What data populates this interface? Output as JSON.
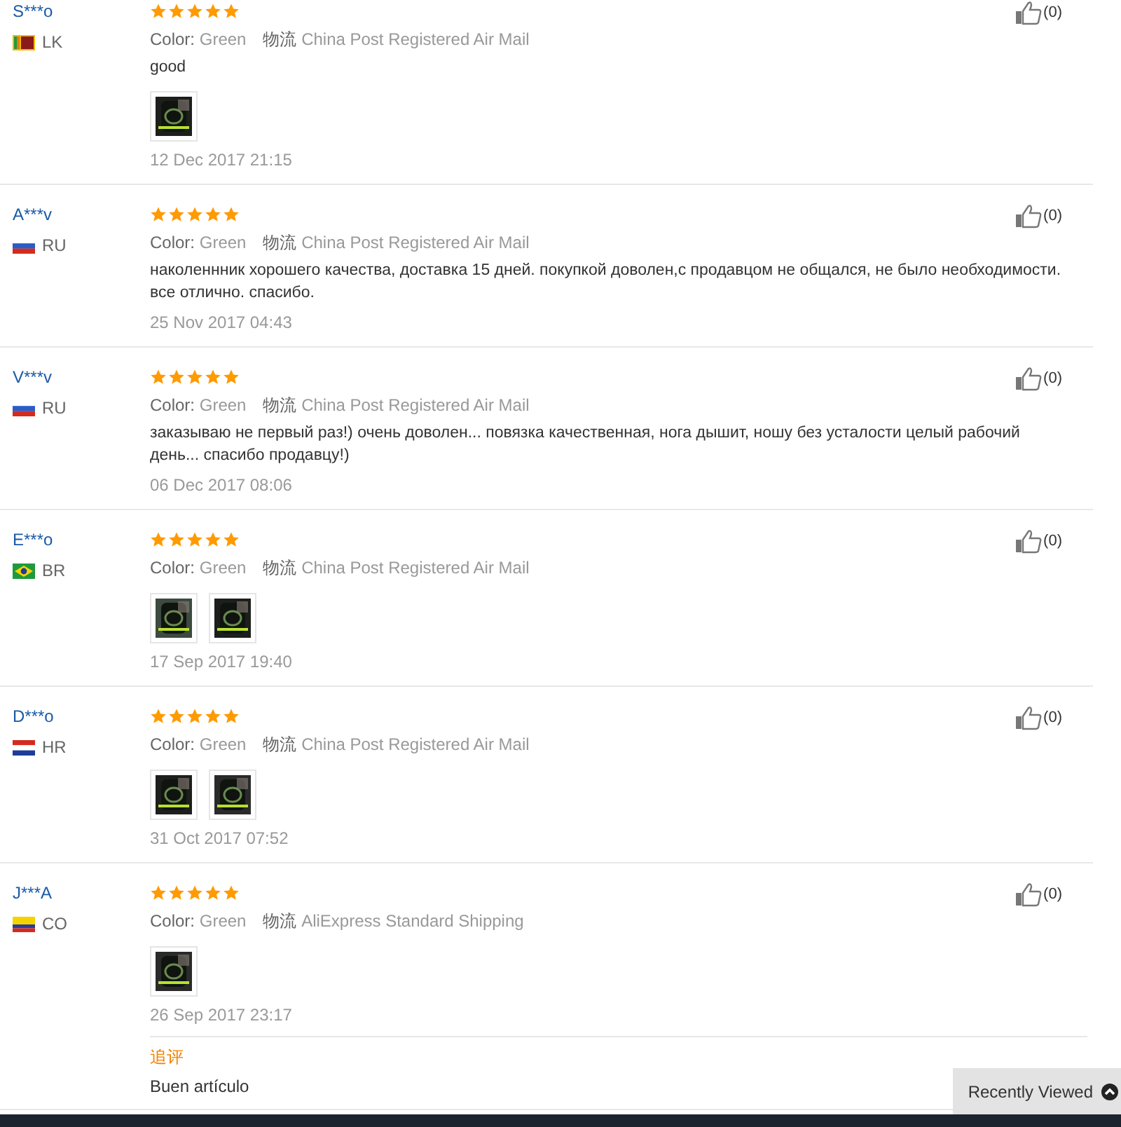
{
  "reviews": [
    {
      "name": "S***o",
      "country": "LK",
      "flag": {
        "kind": "lanka"
      },
      "stars": 5,
      "color_label": "Color:",
      "color_value": "Green",
      "shipping_label": "物流",
      "shipping": "China Post Registered Air Mail",
      "text": "good",
      "photos": [
        {
          "kind": "picture"
        }
      ],
      "date": "12 Dec 2017 21:15",
      "likes": "(0)"
    },
    {
      "name": "A***v",
      "country": "RU",
      "flag": {
        "kind": "russia"
      },
      "stars": 5,
      "color_label": "Color:",
      "color_value": "Green",
      "shipping_label": "物流",
      "shipping": "China Post Registered Air Mail",
      "text": "наколеннник хорошего качества, доставка 15 дней. покупкой доволен,с продавцом не общался, не было необходимости. все отлично. спасибо.",
      "date": "25 Nov 2017 04:43",
      "likes": "(0)"
    },
    {
      "name": "V***v",
      "country": "RU",
      "flag": {
        "kind": "russia"
      },
      "stars": 5,
      "color_label": "Color:",
      "color_value": "Green",
      "shipping_label": "物流",
      "shipping": "China Post Registered Air Mail",
      "text": "заказываю не первый раз!) очень доволен... повязка качественная, нога дышит, ношу без усталости целый рабочий день... спасибо продавцу!)",
      "date": "06 Dec 2017 08:06",
      "likes": "(0)"
    },
    {
      "name": "E***o",
      "country": "BR",
      "flag": {
        "kind": "brazil"
      },
      "stars": 5,
      "color_label": "Color:",
      "color_value": "Green",
      "shipping_label": "物流",
      "shipping": "China Post Registered Air Mail",
      "photos": [
        {
          "kind": "picture"
        },
        {
          "kind": "picture"
        }
      ],
      "date": "17 Sep 2017 19:40",
      "likes": "(0)"
    },
    {
      "name": "D***o",
      "country": "HR",
      "flag": {
        "kind": "croatia"
      },
      "stars": 5,
      "color_label": "Color:",
      "color_value": "Green",
      "shipping_label": "物流",
      "shipping": "China Post Registered Air Mail",
      "photos": [
        {
          "kind": "picture"
        },
        {
          "kind": "picture"
        }
      ],
      "date": "31 Oct 2017 07:52",
      "likes": "(0)"
    },
    {
      "name": "J***A",
      "country": "CO",
      "flag": {
        "kind": "colombia"
      },
      "stars": 5,
      "color_label": "Color:",
      "color_value": "Green",
      "shipping_label": "物流",
      "shipping": "AliExpress Standard Shipping",
      "photos": [
        {
          "kind": "picture"
        }
      ],
      "date": "26 Sep 2017 23:17",
      "likes": "(0)",
      "followup_label": "追评",
      "followup_text": "Buen artículo"
    }
  ],
  "recently_viewed": "Recently Viewed"
}
